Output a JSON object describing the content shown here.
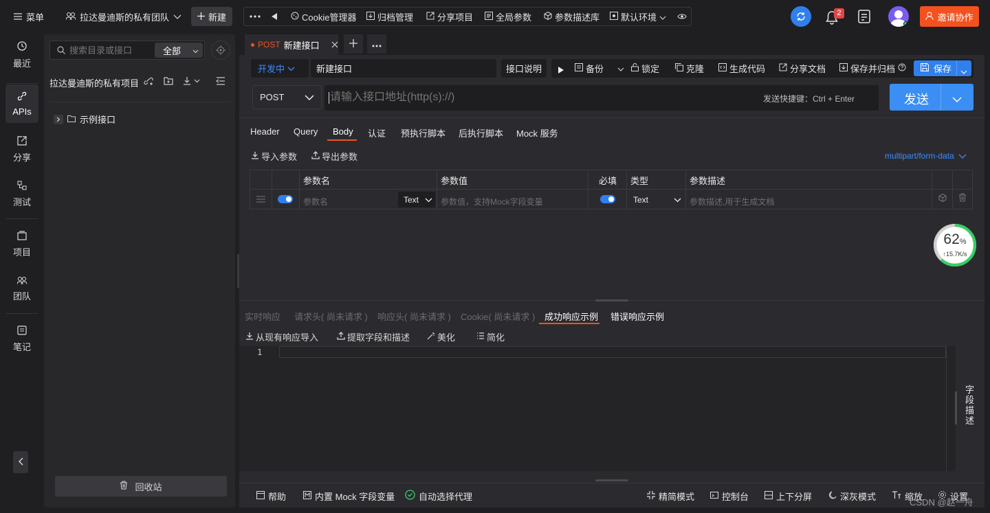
{
  "topbar": {
    "menu_label": "菜单",
    "team_name": "拉达曼迪斯的私有团队",
    "new_label": "新建",
    "tools": [
      "Cookie管理器",
      "归档管理",
      "分享项目",
      "全局参数",
      "参数描述库"
    ],
    "env_label": "默认环境",
    "notification_count": "2",
    "invite_label": "邀请协作"
  },
  "nav": [
    {
      "label": "最近"
    },
    {
      "label": "APIs"
    },
    {
      "label": "分享"
    },
    {
      "label": "测试"
    },
    {
      "label": "项目"
    },
    {
      "label": "团队"
    },
    {
      "label": "笔记"
    }
  ],
  "sidebar": {
    "search_placeholder": "搜索目录或接口",
    "filter_value": "全部",
    "project_title": "拉达曼迪斯的私有项目",
    "tree_item": "示例接口",
    "recycle_label": "回收站"
  },
  "tab": {
    "method": "POST",
    "name": "新建接口"
  },
  "request": {
    "status": "开发中",
    "name": "新建接口",
    "doc_label": "接口说明",
    "actions": [
      "备份",
      "锁定",
      "克隆",
      "生成代码",
      "分享文档",
      "保存并归档"
    ],
    "save_label": "保存",
    "method": "POST",
    "url_placeholder": "请输入接口地址(http(s)://)",
    "shortcut_hint": "发送快捷键：Ctrl + Enter",
    "send_label": "发送"
  },
  "req_tabs": [
    "Header",
    "Query",
    "Body",
    "认证",
    "预执行脚本",
    "后执行脚本",
    "Mock 服务"
  ],
  "active_req_tab": "Body",
  "params": {
    "import_label": "导入参数",
    "export_label": "导出参数",
    "body_type": "multipart/form-data",
    "headers": [
      "参数名",
      "参数值",
      "必填",
      "类型",
      "参数描述"
    ],
    "row": {
      "name_placeholder": "参数名",
      "name_type": "Text",
      "value_placeholder": "参数值，支持Mock字段变量",
      "type": "Text",
      "desc_placeholder": "参数描述,用于生成文档"
    }
  },
  "speed_widget": {
    "percent": "62",
    "unit": "%",
    "rate": "↑15.7K/s",
    "percent_value": 62
  },
  "resp_tabs": [
    "实时响应",
    "请求头( 尚未请求 )",
    "响应头( 尚未请求 )",
    "Cookie( 尚未请求 )",
    "成功响应示例",
    "错误响应示例"
  ],
  "resp_tools": [
    "从现有响应导入",
    "提取字段和描述",
    "美化",
    "简化"
  ],
  "editor": {
    "line_number": "1",
    "side_label": "字段描述"
  },
  "bottombar": {
    "left": [
      "帮助",
      "内置 Mock 字段变量",
      "自动选择代理"
    ],
    "right": [
      "精简模式",
      "控制台",
      "上下分屏",
      "深灰模式",
      "缩放",
      "设置"
    ],
    "watermark": "CSDN @赵一舟"
  }
}
